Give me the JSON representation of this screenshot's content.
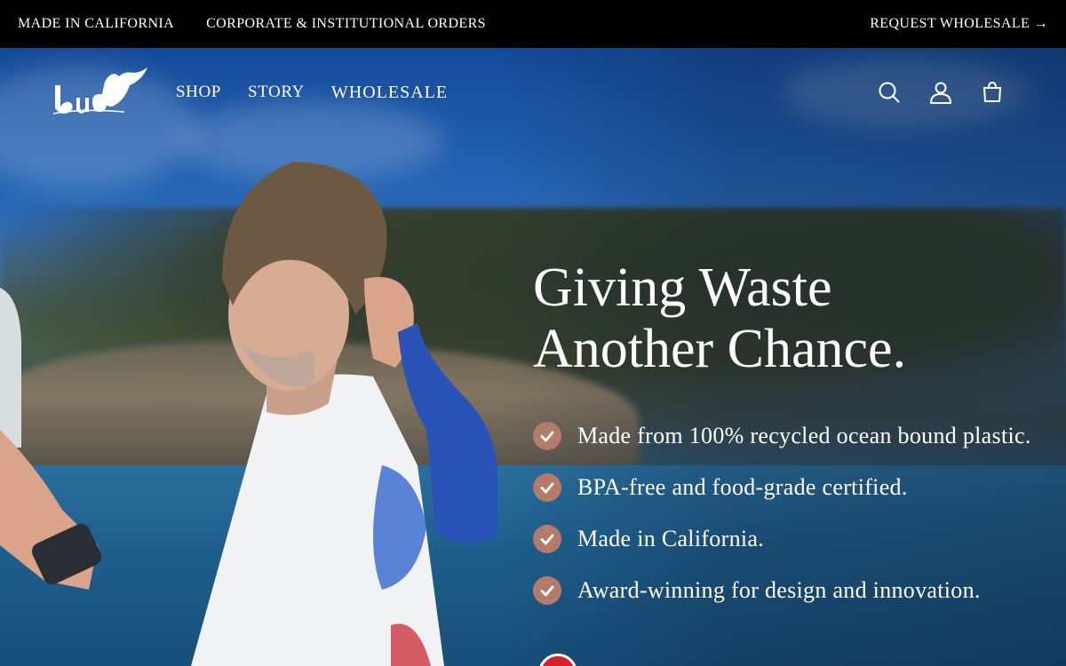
{
  "topbar": {
    "made_in": "MADE IN CALIFORNIA",
    "corporate": "CORPORATE & INSTITUTIONAL ORDERS",
    "request": "REQUEST WHOLESALE →"
  },
  "header": {
    "logo_text": "buoy",
    "nav": [
      {
        "label": "SHOP"
      },
      {
        "label": "STORY"
      },
      {
        "label": "WHOLESALE"
      }
    ],
    "icons": [
      "search-icon",
      "account-icon",
      "cart-icon"
    ]
  },
  "hero": {
    "headline_line1": "Giving Waste",
    "headline_line2": "Another Chance.",
    "features": [
      "Made from 100% recycled ocean bound plastic.",
      "BPA-free and food-grade certified.",
      "Made in California.",
      "Award-winning for design and innovation."
    ],
    "check_color": "#b57b6a"
  }
}
